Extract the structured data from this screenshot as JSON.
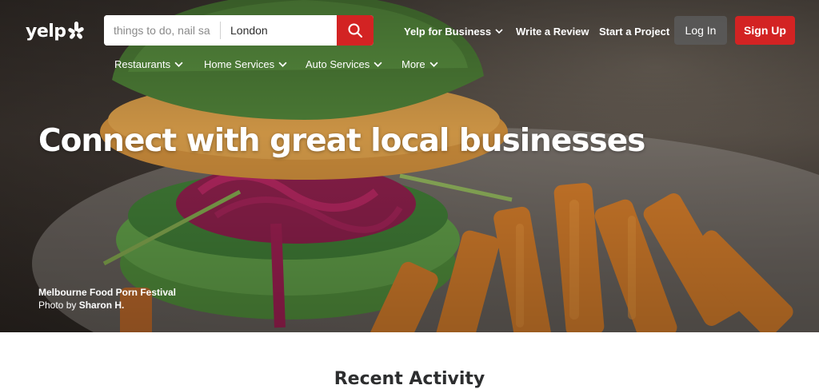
{
  "logo": {
    "text": "yelp"
  },
  "search": {
    "find_placeholder": "things to do, nail salons, plumbers",
    "near_value": "London"
  },
  "header": {
    "yelp_for_business": "Yelp for Business",
    "write_review": "Write a Review",
    "start_project": "Start a Project",
    "login": "Log In",
    "signup": "Sign Up"
  },
  "categories": [
    {
      "label": "Restaurants"
    },
    {
      "label": "Home Services"
    },
    {
      "label": "Auto Services"
    },
    {
      "label": "More"
    }
  ],
  "hero": {
    "headline": "Connect with great local businesses",
    "photo_title": "Melbourne Food Porn Festival",
    "photo_by_prefix": "Photo by",
    "photo_author": "Sharon H."
  },
  "sections": {
    "recent_activity": "Recent Activity"
  },
  "colors": {
    "brand_red": "#d32323",
    "login_bg": "#5a5a5a",
    "text_dark": "#2d2e2f"
  },
  "icons": [
    "burst-icon",
    "search-icon",
    "chevron-down-icon"
  ]
}
